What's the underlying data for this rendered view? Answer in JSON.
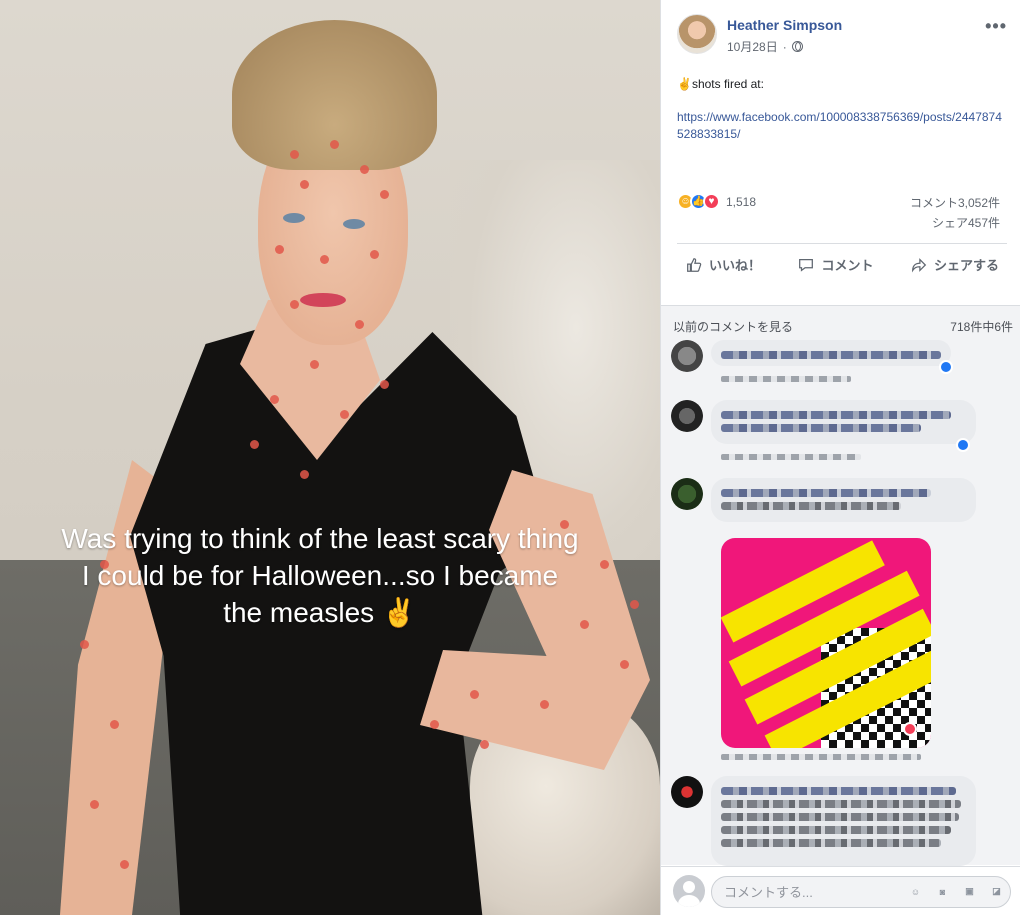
{
  "photo": {
    "caption": "Was trying to think of the least scary thing I could be for Halloween...so I became the measles ✌"
  },
  "post": {
    "author": "Heather Simpson",
    "date": "10月28日",
    "text": "✌shots fired at:",
    "link": "https://www.facebook.com/100008338756369/posts/2447874528833815/",
    "reaction_count": "1,518",
    "comment_count": "コメント3,052件",
    "share_count": "シェア457件"
  },
  "actions": {
    "like": "いいね！",
    "comment": "コメント",
    "share": "シェアする"
  },
  "comments": {
    "previous_link": "以前のコメントを見る",
    "paging": "718件中6件"
  },
  "compose": {
    "placeholder": "コメントする..."
  },
  "colors": {
    "link": "#385898",
    "like": "#2078f4",
    "love": "#f33e58",
    "haha": "#f7b125",
    "meme_pink": "#f0177a",
    "meme_yellow": "#f7e400"
  }
}
